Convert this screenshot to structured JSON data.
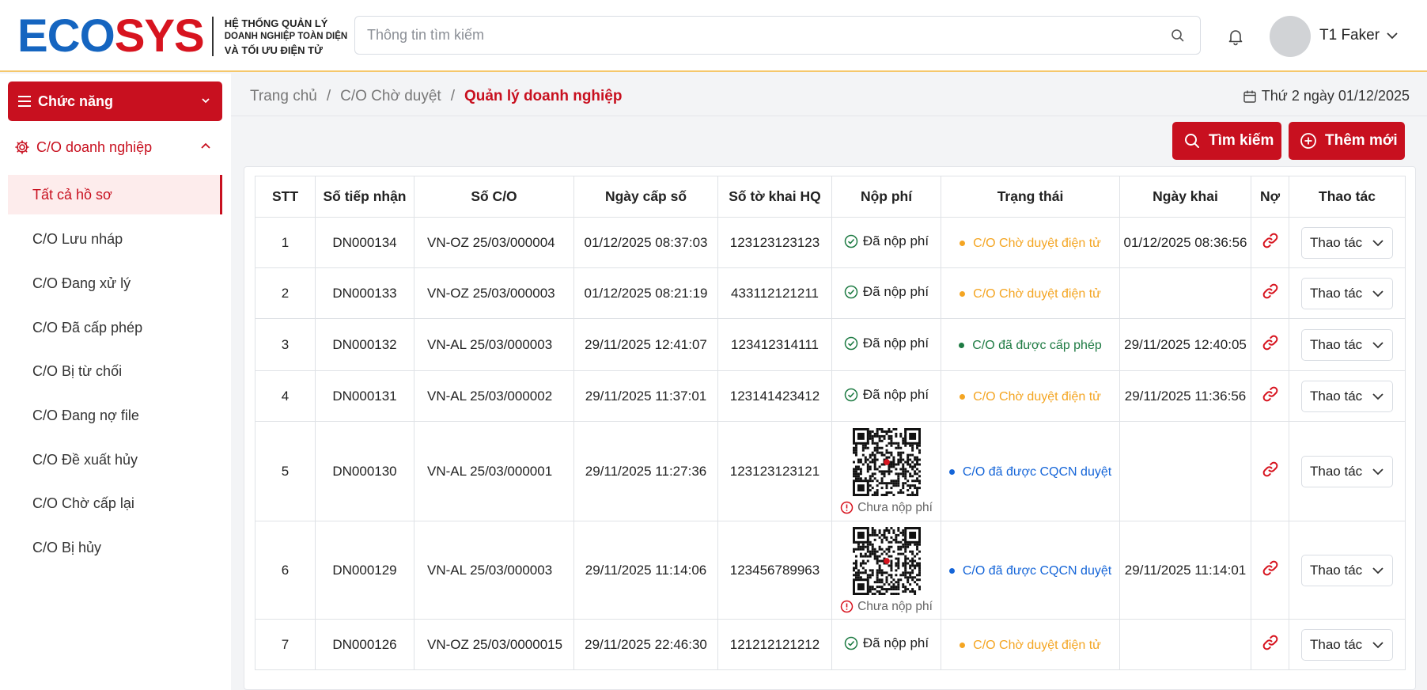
{
  "brand": {
    "logo_left": "ECO",
    "logo_right": "SYS",
    "subtitle_1": "HỆ THỐNG QUẢN LÝ",
    "subtitle_2": "DOANH NGHIỆP TOÀN DIỆN",
    "subtitle_3": "VÀ TỐI ƯU ĐIỆN TỬ",
    "colors": {
      "primary": "#c8101f",
      "blue": "#1565c0"
    }
  },
  "header": {
    "search_placeholder": "Thông tin tìm kiếm",
    "user_name": "T1 Faker"
  },
  "sidebar": {
    "function_label": "Chức năng",
    "group_label": "C/O doanh nghiệp",
    "items": [
      {
        "label": "Tất cả hồ sơ",
        "active": true
      },
      {
        "label": "C/O Lưu nháp"
      },
      {
        "label": "C/O Đang xử lý"
      },
      {
        "label": "C/O Đã cấp phép"
      },
      {
        "label": "C/O Bị từ chối"
      },
      {
        "label": "C/O Đang nợ file"
      },
      {
        "label": "C/O Đề xuất hủy"
      },
      {
        "label": "C/O Chờ cấp lại"
      },
      {
        "label": "C/O Bị hủy"
      }
    ]
  },
  "breadcrumb": {
    "home": "Trang chủ",
    "sep": "/",
    "parent": "C/O Chờ duyệt",
    "current": "Quản lý doanh nghiệp"
  },
  "date_label": "Thứ 2 ngày 01/12/2025",
  "toolbar": {
    "search_label": "Tìm kiếm",
    "add_label": "Thêm mới"
  },
  "table": {
    "headers": [
      "STT",
      "Số tiếp nhận",
      "Số C/O",
      "Ngày cấp số",
      "Số tờ khai HQ",
      "Nộp phí",
      "Trạng thái",
      "Ngày khai",
      "Nợ",
      "Thao tác"
    ],
    "action_label": "Thao tác",
    "rows": [
      {
        "stt": "1",
        "receipt": "DN000134",
        "co": "VN-OZ 25/03/000004",
        "issued": "01/12/2025 08:37:03",
        "customs": "123123123123",
        "fee": "Đã nộp phí",
        "status": "C/O Chờ duyệt điện tử",
        "declared": "01/12/2025 08:36:56"
      },
      {
        "stt": "2",
        "receipt": "DN000133",
        "co": "VN-OZ 25/03/000003",
        "issued": "01/12/2025 08:21:19",
        "customs": "433112121211",
        "fee": "Đã nộp phí",
        "status": "C/O Chờ duyệt điện tử",
        "declared": ""
      },
      {
        "stt": "3",
        "receipt": "DN000132",
        "co": "VN-AL 25/03/000003",
        "issued": "29/11/2025 12:41:07",
        "customs": "123412314111",
        "fee": "Đã nộp phí",
        "status": "C/O đã được cấp phép",
        "declared": "29/11/2025 12:40:05"
      },
      {
        "stt": "4",
        "receipt": "DN000131",
        "co": "VN-AL 25/03/000002",
        "issued": "29/11/2025 11:37:01",
        "customs": "123141423412",
        "fee": "Đã nộp phí",
        "status": "C/O Chờ duyệt điện tử",
        "declared": "29/11/2025 11:36:56"
      },
      {
        "stt": "5",
        "receipt": "DN000130",
        "co": "VN-AL 25/03/000001",
        "issued": "29/11/2025 11:27:36",
        "customs": "123123123121",
        "fee": "Chưa nộp phí",
        "status": "C/O đã được CQCN duyệt",
        "declared": ""
      },
      {
        "stt": "6",
        "receipt": "DN000129",
        "co": "VN-AL 25/03/000003",
        "issued": "29/11/2025 11:14:06",
        "customs": "123456789963",
        "fee": "Chưa nộp phí",
        "status": "C/O đã được CQCN duyệt",
        "declared": "29/11/2025 11:14:01"
      },
      {
        "stt": "7",
        "receipt": "DN000126",
        "co": "VN-OZ 25/03/0000015",
        "issued": "29/11/2025 22:46:30",
        "customs": "121212121212",
        "fee": "Đã nộp phí",
        "status": "C/O Chờ duyệt điện tử",
        "declared": ""
      }
    ]
  }
}
